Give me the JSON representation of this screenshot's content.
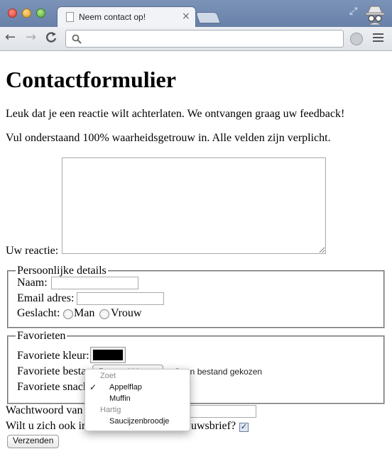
{
  "browser": {
    "tab_title": "Neem contact op!",
    "tab_close": "×",
    "nav_back": "←",
    "nav_forward": "→",
    "nav_reload": "C",
    "omnibox_value": "",
    "icons": [
      "page-icon",
      "close-icon",
      "fullscreen-icon",
      "incognito-icon",
      "search-icon",
      "extension-icon",
      "menu-icon"
    ]
  },
  "page": {
    "title": "Contactformulier",
    "intro": "Leuk dat je een reactie wilt achterlaten. We ontvangen graag uw feedback!",
    "instructions": "Vul onderstaand 100% waarheidsgetrouw in. Alle velden zijn verplicht.",
    "reaction_label": "Uw reactie:",
    "reaction_value": ""
  },
  "personal": {
    "legend": "Persoonlijke details",
    "name_label": "Naam:",
    "email_label": "Email adres:",
    "gender_label": "Geslacht:",
    "gender_male": "Man",
    "gender_female": "Vrouw"
  },
  "favorites": {
    "legend": "Favorieten",
    "color_label": "Favoriete kleur:",
    "color_value": "#000000",
    "file_label": "Favoriete besta",
    "file_button": "Bestand kiezen",
    "file_status": "Geen bestand gekozen",
    "snack_label": "Favoriete snack"
  },
  "password_label": "Wachtwoord van",
  "newsletter_label_start": "Wilt u zich ook in",
  "newsletter_label_end": "uwsbrief?",
  "newsletter_checked": true,
  "submit_label": "Verzenden",
  "dropdown": {
    "group1": "Zoet",
    "option1": "Appelflap",
    "option2": "Muffin",
    "group2": "Hartig",
    "option3": "Saucijzenbroodje",
    "checkmark": "✓",
    "selected": "Appelflap"
  }
}
